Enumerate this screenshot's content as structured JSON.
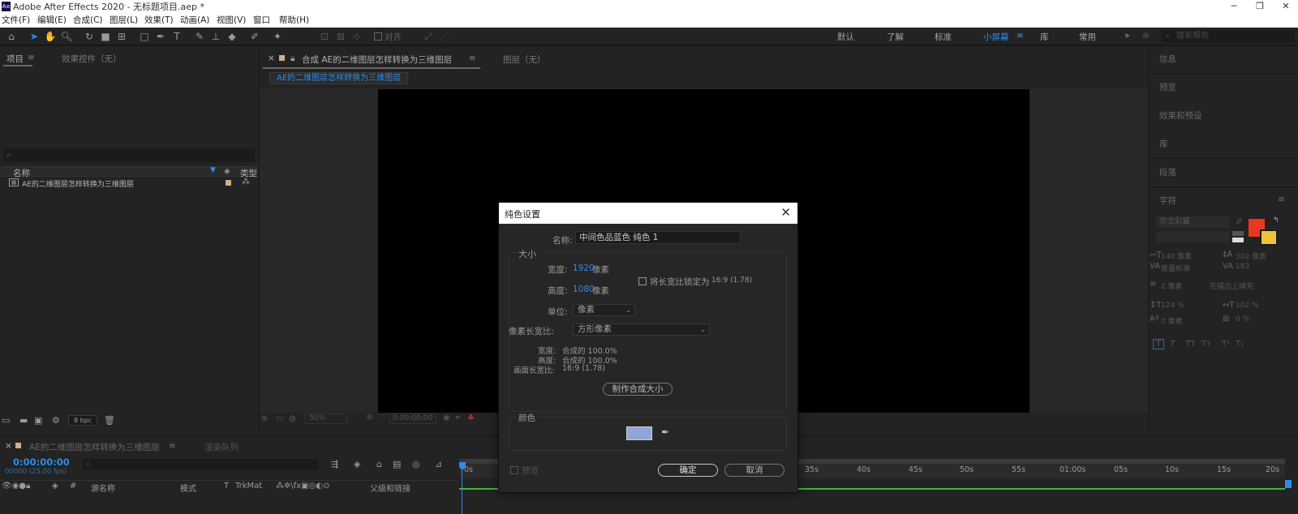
{
  "titlebar": {
    "app_icon": "Ae",
    "title": "Adobe After Effects 2020 - 无标题项目.aep *"
  },
  "menubar": [
    "文件(F)",
    "编辑(E)",
    "合成(C)",
    "图层(L)",
    "效果(T)",
    "动画(A)",
    "视图(V)",
    "窗口",
    "帮助(H)"
  ],
  "toolbar": {
    "align_label": "对齐",
    "workspaces": [
      "默认",
      "了解",
      "标准",
      "小屏幕",
      "库",
      "常用"
    ],
    "active_workspace": "小屏幕",
    "search_placeholder": "搜索帮助"
  },
  "project_panel": {
    "tab_project": "项目",
    "tab_effects": "效果控件（无）",
    "col_name": "名称",
    "col_type": "类型",
    "item_name": "AE的二维图层怎样转换为三维图层",
    "bpc": "8 bpc"
  },
  "comp_panel": {
    "tab_comp": "合成 AE的二维图层怎样转换为三维图层",
    "tab_layer": "图层（无）",
    "breadcrumb": "AE的二维图层怎样转换为三维图层",
    "zoom": "50%",
    "timecode": "0:00:00:00"
  },
  "right_panel": {
    "items": [
      "信息",
      "预览",
      "效果和预设",
      "库",
      "段落",
      "字符"
    ],
    "font_name": "华文彩翼",
    "font_size": "140 像素",
    "leading": "302 像素",
    "kerning": "度量标准",
    "tracking": "183",
    "stroke_width": "2 像素",
    "stroke_mode": "在描边上填充",
    "vscale": "124 %",
    "hscale": "102 %",
    "baseline": "0 像素",
    "tsume": "0 %",
    "colors": {
      "fill": "#e8391e",
      "stroke": "#f3c03a"
    }
  },
  "dialog": {
    "title": "纯色设置",
    "name_label": "名称:",
    "name_value": "中间色品蓝色 纯色 1",
    "size_group": "大小",
    "width_label": "宽度:",
    "width_value": "1920",
    "width_unit": "像素",
    "height_label": "高度:",
    "height_value": "1080",
    "height_unit": "像素",
    "lock_label": "将长宽比锁定为",
    "lock_ratio": "16:9 (1.78)",
    "unit_label": "单位:",
    "unit_value": "像素",
    "par_label": "像素长宽比:",
    "par_value": "方形像素",
    "pct_width_label": "宽度:",
    "pct_width_value": "合成的 100.0%",
    "pct_height_label": "高度:",
    "pct_height_value": "合成的 100.0%",
    "frame_ar_label": "画面长宽比:",
    "frame_ar_value": "16:9 (1.78)",
    "make_comp_size": "制作合成大小",
    "color_group": "颜色",
    "color_value": "#8fa6d6",
    "preview_label": "预览",
    "ok": "确定",
    "cancel": "取消"
  },
  "timeline": {
    "tab_comp": "AE的二维图层怎样转换为三维图层",
    "tab_render": "渲染队列",
    "timecode": "0:00:00:00",
    "frame_info": "00000 (25.00 fps)",
    "cols": [
      "源名称",
      "模式",
      "T",
      "TrkMat",
      "父级和链接"
    ],
    "ruler": [
      "0s",
      "35s",
      "40s",
      "45s",
      "50s",
      "55s",
      "01:00s",
      "05s",
      "10s",
      "15s",
      "20s"
    ]
  }
}
